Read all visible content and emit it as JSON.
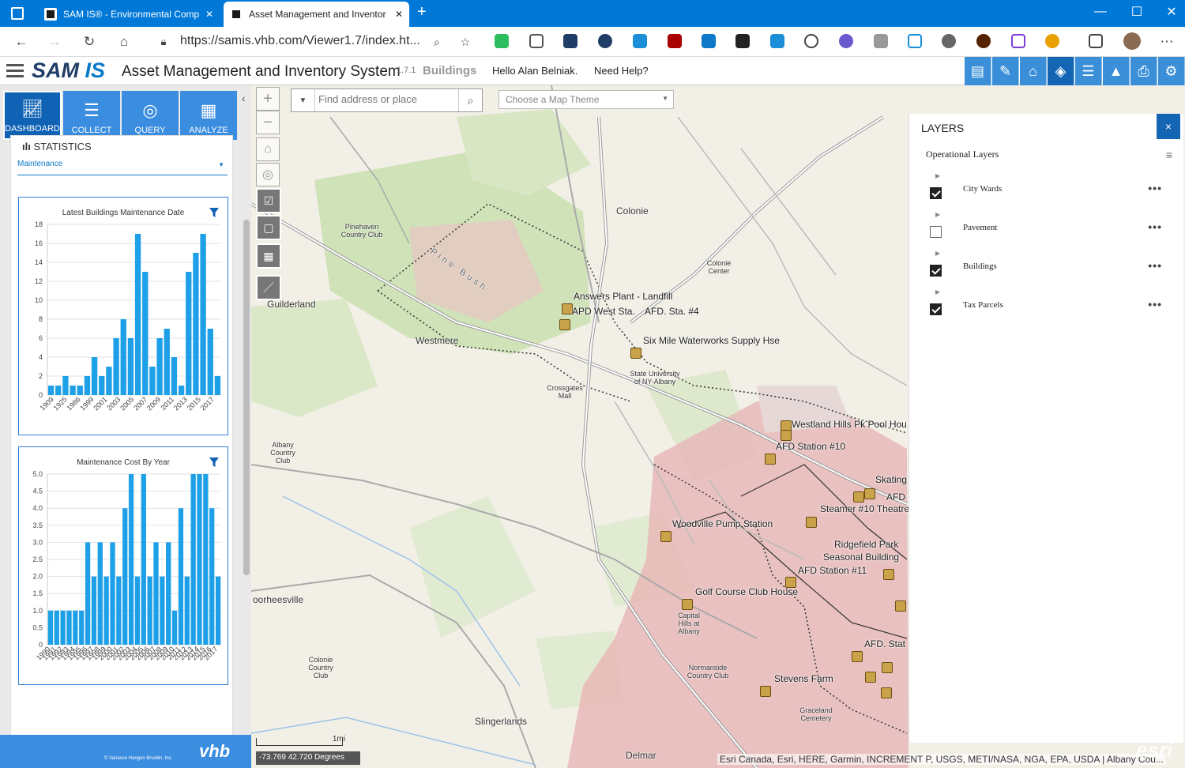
{
  "browser": {
    "tabs": [
      {
        "label": "SAM IS® - Environmental Comp"
      },
      {
        "label": "Asset Management and Inventor"
      }
    ],
    "new_tab": "+",
    "url": "https://samis.vhb.com/Viewer1.7/index.ht..."
  },
  "app": {
    "logo_a": "SAM ",
    "logo_b": "IS",
    "title": "Asset Management and Inventory System",
    "version": "1.7.1",
    "subtitle": "Buildings",
    "greeting": "Hello Alan Belniak.",
    "help": "Need Help?"
  },
  "left": {
    "buttons": [
      {
        "label": "DASHBOARD"
      },
      {
        "label": "COLLECT"
      },
      {
        "label": "QUERY"
      },
      {
        "label": "ANALYZE"
      }
    ],
    "statistics_title": "STATISTICS",
    "statistics_select": "Maintenance",
    "copyright": "© Vanasse Hangen Brustlin, Inc.",
    "vhb_logo": "vhb"
  },
  "chart_data": [
    {
      "type": "bar",
      "title": "Latest Buildings Maintenance Date",
      "color": "#1ea0e8",
      "ylim": [
        0,
        18
      ],
      "yticks": [
        "0",
        "2",
        "4",
        "6",
        "8",
        "10",
        "12",
        "14",
        "16",
        "18"
      ],
      "xtick_labels": [
        "1909",
        "1925",
        "1986",
        "1999",
        "2001",
        "2003",
        "2005",
        "2007",
        "2009",
        "2011",
        "2013",
        "2015",
        "2017"
      ],
      "values": [
        1,
        1,
        2,
        1,
        1,
        2,
        4,
        2,
        3,
        6,
        8,
        6,
        17,
        13,
        3,
        6,
        7,
        4,
        1,
        13,
        15,
        17,
        7,
        2
      ]
    },
    {
      "type": "bar",
      "title": "Maintenance Cost By Year",
      "color": "#1ea0e8",
      "ylim": [
        0,
        5
      ],
      "yticks": [
        "0",
        "0.5",
        "1.0",
        "1.5",
        "2.0",
        "2.5",
        "3.0",
        "3.5",
        "4.0",
        "4.5",
        "5.0"
      ],
      "xtick_labels": [
        "1990",
        "1991",
        "1992",
        "1993",
        "1994",
        "1995",
        "1996",
        "1997",
        "1998",
        "1999",
        "2000",
        "2001",
        "2002",
        "2003",
        "2004",
        "2005",
        "2006",
        "2007",
        "2008",
        "2009",
        "2010",
        "2011",
        "2012",
        "2013",
        "2014",
        "2015",
        "2016",
        "2017"
      ],
      "values": [
        1,
        1,
        1,
        1,
        1,
        1,
        3,
        2,
        3,
        2,
        3,
        2,
        4,
        5,
        2,
        5,
        2,
        3,
        2,
        3,
        1,
        4,
        2,
        5,
        5,
        5,
        4,
        2
      ]
    }
  ],
  "map": {
    "search_placeholder": "Find address or place",
    "theme_placeholder": "Choose a Map Theme",
    "coords": "-73.769 42.720 Degrees",
    "scale": "1mi",
    "attribution": "Esri Canada, Esri, HERE, Garmin, INCREMENT P, USGS, METI/NASA, NGA, EPA, USDA | Albany Cou...",
    "esri": "esri",
    "places": [
      "Colonie",
      "Guilderland",
      "Westmere",
      "Slingerlands",
      "Delmar",
      "oorheesville",
      "Crossgates Mall",
      "State University of NY-Albany",
      "Pinehaven Country Club",
      "Colonie Center",
      "Albany Country Club",
      "Normanside Country Club",
      "Colonie Country Club",
      "Capital Hills at Albany",
      "Graceland Cemetery",
      "Pine Bush"
    ],
    "poi": [
      "Answers Plant - Landfill",
      "APD West Sta.",
      "AFD. Sta. #4",
      "Six Mile Waterworks Supply Hse",
      "Westland Hills Pk Pool Hou",
      "AFD Station #10",
      "Woodville Pump Station",
      "Ridgefield Park",
      "Seasonal Building",
      "AFD Station #11",
      "Golf Course Club House",
      "Stevens Farm",
      "Skating",
      "AFD",
      "Steamer #10 Theatre",
      "AFD. Stat"
    ]
  },
  "layers": {
    "title": "LAYERS",
    "close": "×",
    "operational": "Operational Layers",
    "items": [
      {
        "name": "City Wards",
        "checked": true
      },
      {
        "name": "Pavement",
        "checked": false
      },
      {
        "name": "Buildings",
        "checked": true
      },
      {
        "name": "Tax Parcels",
        "checked": true
      }
    ],
    "more": "•••"
  }
}
